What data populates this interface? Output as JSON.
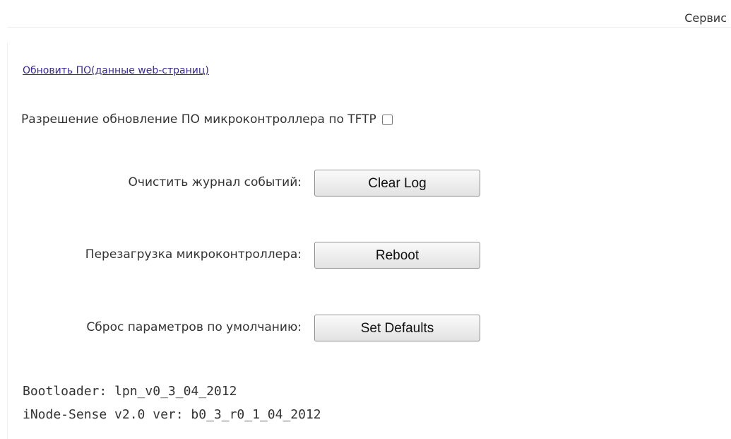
{
  "header": {
    "title": "Сервис"
  },
  "update_link": {
    "label": "Обновить ПО(данные web-страниц)"
  },
  "tftp": {
    "label": "Разрешение обновление ПО микроконтроллера по TFTP",
    "checked": false
  },
  "actions": [
    {
      "label": "Очистить журнал событий:",
      "button": "Clear Log"
    },
    {
      "label": "Перезагрузка микроконтроллера:",
      "button": "Reboot"
    },
    {
      "label": "Сброс параметров по умолчанию:",
      "button": "Set Defaults"
    }
  ],
  "versions": {
    "bootloader": "Bootloader: lpn_v0_3_04_2012",
    "firmware": "iNode-Sense v2.0 ver: b0_3_r0_1_04_2012"
  }
}
